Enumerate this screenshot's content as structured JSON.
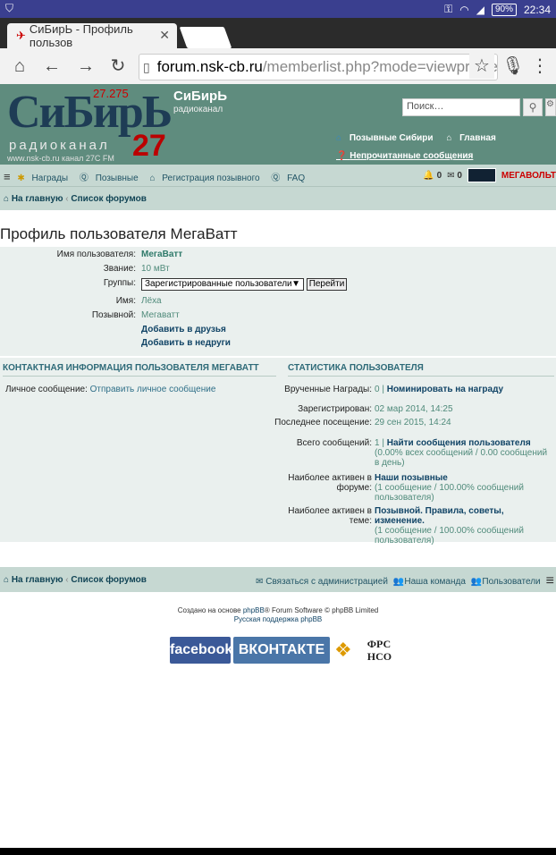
{
  "status_bar": {
    "time": "22:34",
    "battery": "90%"
  },
  "browser": {
    "tab_title": "СиБирЬ - Профиль пользов",
    "url_domain": "forum.nsk-cb.ru",
    "url_path": "/memberlist.php?mode=viewprofile&u="
  },
  "header": {
    "logo_text": "СиБирЬ",
    "logo_freq": "27.275",
    "logo_radio": "радиоканал",
    "logo_url": "www.nsk-cb.ru канал 27C FM",
    "logo_27": "27",
    "site_name": "СиБирЬ",
    "site_desc": "радиоканал",
    "search_placeholder": "Поиск…",
    "link_callsigns": "Позывные Сибири",
    "link_home": "Главная",
    "link_unread": "Непрочитанные сообщения"
  },
  "navbar": {
    "awards": "Награды",
    "callsigns": "Позывные",
    "register": "Регистрация позывного",
    "faq": "FAQ",
    "notif_count": "0",
    "msg_count": "0",
    "username": "МЕГАВОЛЬТ"
  },
  "breadcrumb": {
    "home": "На главную",
    "forums": "Список форумов"
  },
  "page_title": "Профиль пользователя МегаВатт",
  "profile": {
    "username_label": "Имя пользователя:",
    "username": "МегаВатт",
    "rank_label": "Звание:",
    "rank": "10 мВт",
    "groups_label": "Группы:",
    "groups_selected": "Зарегистрированные пользователи",
    "go_button": "Перейти",
    "name_label": "Имя:",
    "name": "Лёха",
    "callsign_label": "Позывной:",
    "callsign": "Мегаватт",
    "add_friend": "Добавить в друзья",
    "add_foe": "Добавить в недруги"
  },
  "contact": {
    "heading": "КОНТАКТНАЯ ИНФОРМАЦИЯ ПОЛЬЗОВАТЕЛЯ МЕГАВАТТ",
    "pm_label": "Личное сообщение:",
    "pm_link": "Отправить личное сообщение"
  },
  "stats": {
    "heading": "СТАТИСТИКА ПОЛЬЗОВАТЕЛЯ",
    "awards_label": "Врученные Награды:",
    "awards_value": "0 |",
    "awards_link": "Номинировать на награду",
    "registered_label": "Зарегистрирован:",
    "registered_value": "02 мар 2014, 14:25",
    "last_visit_label": "Последнее посещение:",
    "last_visit_value": "29 сен 2015, 14:24",
    "posts_label": "Всего сообщений:",
    "posts_value": "1 |",
    "posts_link": "Найти сообщения пользователя",
    "posts_detail": "(0.00% всех сообщений / 0.00 сообщений в день)",
    "active_forum_label": "Наиболее активен в форуме:",
    "active_forum_link": "Наши позывные",
    "active_forum_detail": "(1 сообщение / 100.00% сообщений пользователя)",
    "active_topic_label": "Наиболее активен в теме:",
    "active_topic_link": "Позывной. Правила, советы, изменение.",
    "active_topic_detail": "(1 сообщение / 100.00% сообщений пользователя)"
  },
  "footer": {
    "home": "На главную",
    "forums": "Список форумов",
    "contact_admin": "Связаться с администрацией",
    "team": "Наша команда",
    "users": "Пользователи",
    "credit_prefix": "Создано на основе",
    "credit_phpbb": "phpBB",
    "credit_suffix": "® Forum Software © phpBB Limited",
    "credit_ru": "Русская поддержка phpBB",
    "badge_facebook": "facebook",
    "badge_vk": "ВКОНТАКТЕ",
    "badge_frs1": "ФРС",
    "badge_frs2": "НСО"
  }
}
